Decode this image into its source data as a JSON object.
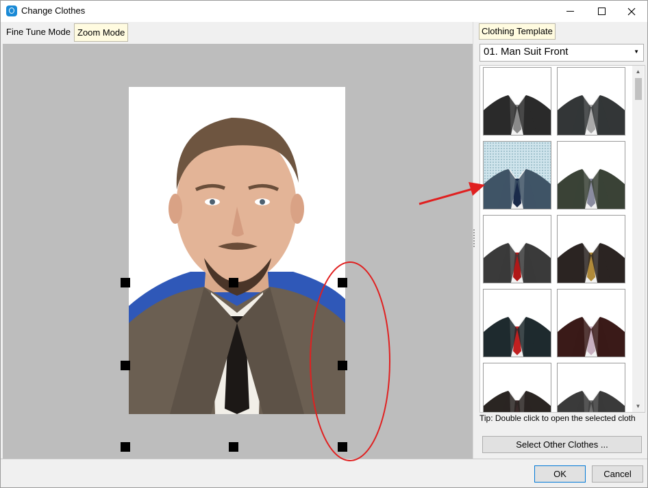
{
  "window": {
    "title": "Change Clothes",
    "icon": "app-icon",
    "controls": {
      "minimize": "minimize-icon",
      "maximize": "maximize-icon",
      "close": "close-icon"
    }
  },
  "tabs": [
    {
      "label": "Fine Tune Mode",
      "active": false
    },
    {
      "label": "Zoom Mode",
      "active": true
    }
  ],
  "right_panel": {
    "header": "Clothing Template",
    "dropdown": {
      "value": "01. Man Suit Front"
    },
    "selected_thumbnail": 3,
    "tip": "Tip: Double click to open the selected cloth",
    "select_other_label": "Select Other Clothes ..."
  },
  "colors": {
    "annotation": "#e02020",
    "suits": [
      "#2a2a2a",
      "#333637",
      "#3f5466",
      "#3a4236",
      "#3a3a3a",
      "#2b2422",
      "#1e2a2e",
      "#3a1a18",
      "#2a2522",
      "#3a3a3a"
    ],
    "ties": [
      "#8a8a8a",
      "#aaaaaa",
      "#1a2a4a",
      "#8a8ca0",
      "#b01818",
      "#b08a3a",
      "#c02020",
      "#c8b0c0",
      "#3a2a2a",
      "#707070"
    ]
  },
  "footer": {
    "ok_label": "OK",
    "cancel_label": "Cancel"
  }
}
